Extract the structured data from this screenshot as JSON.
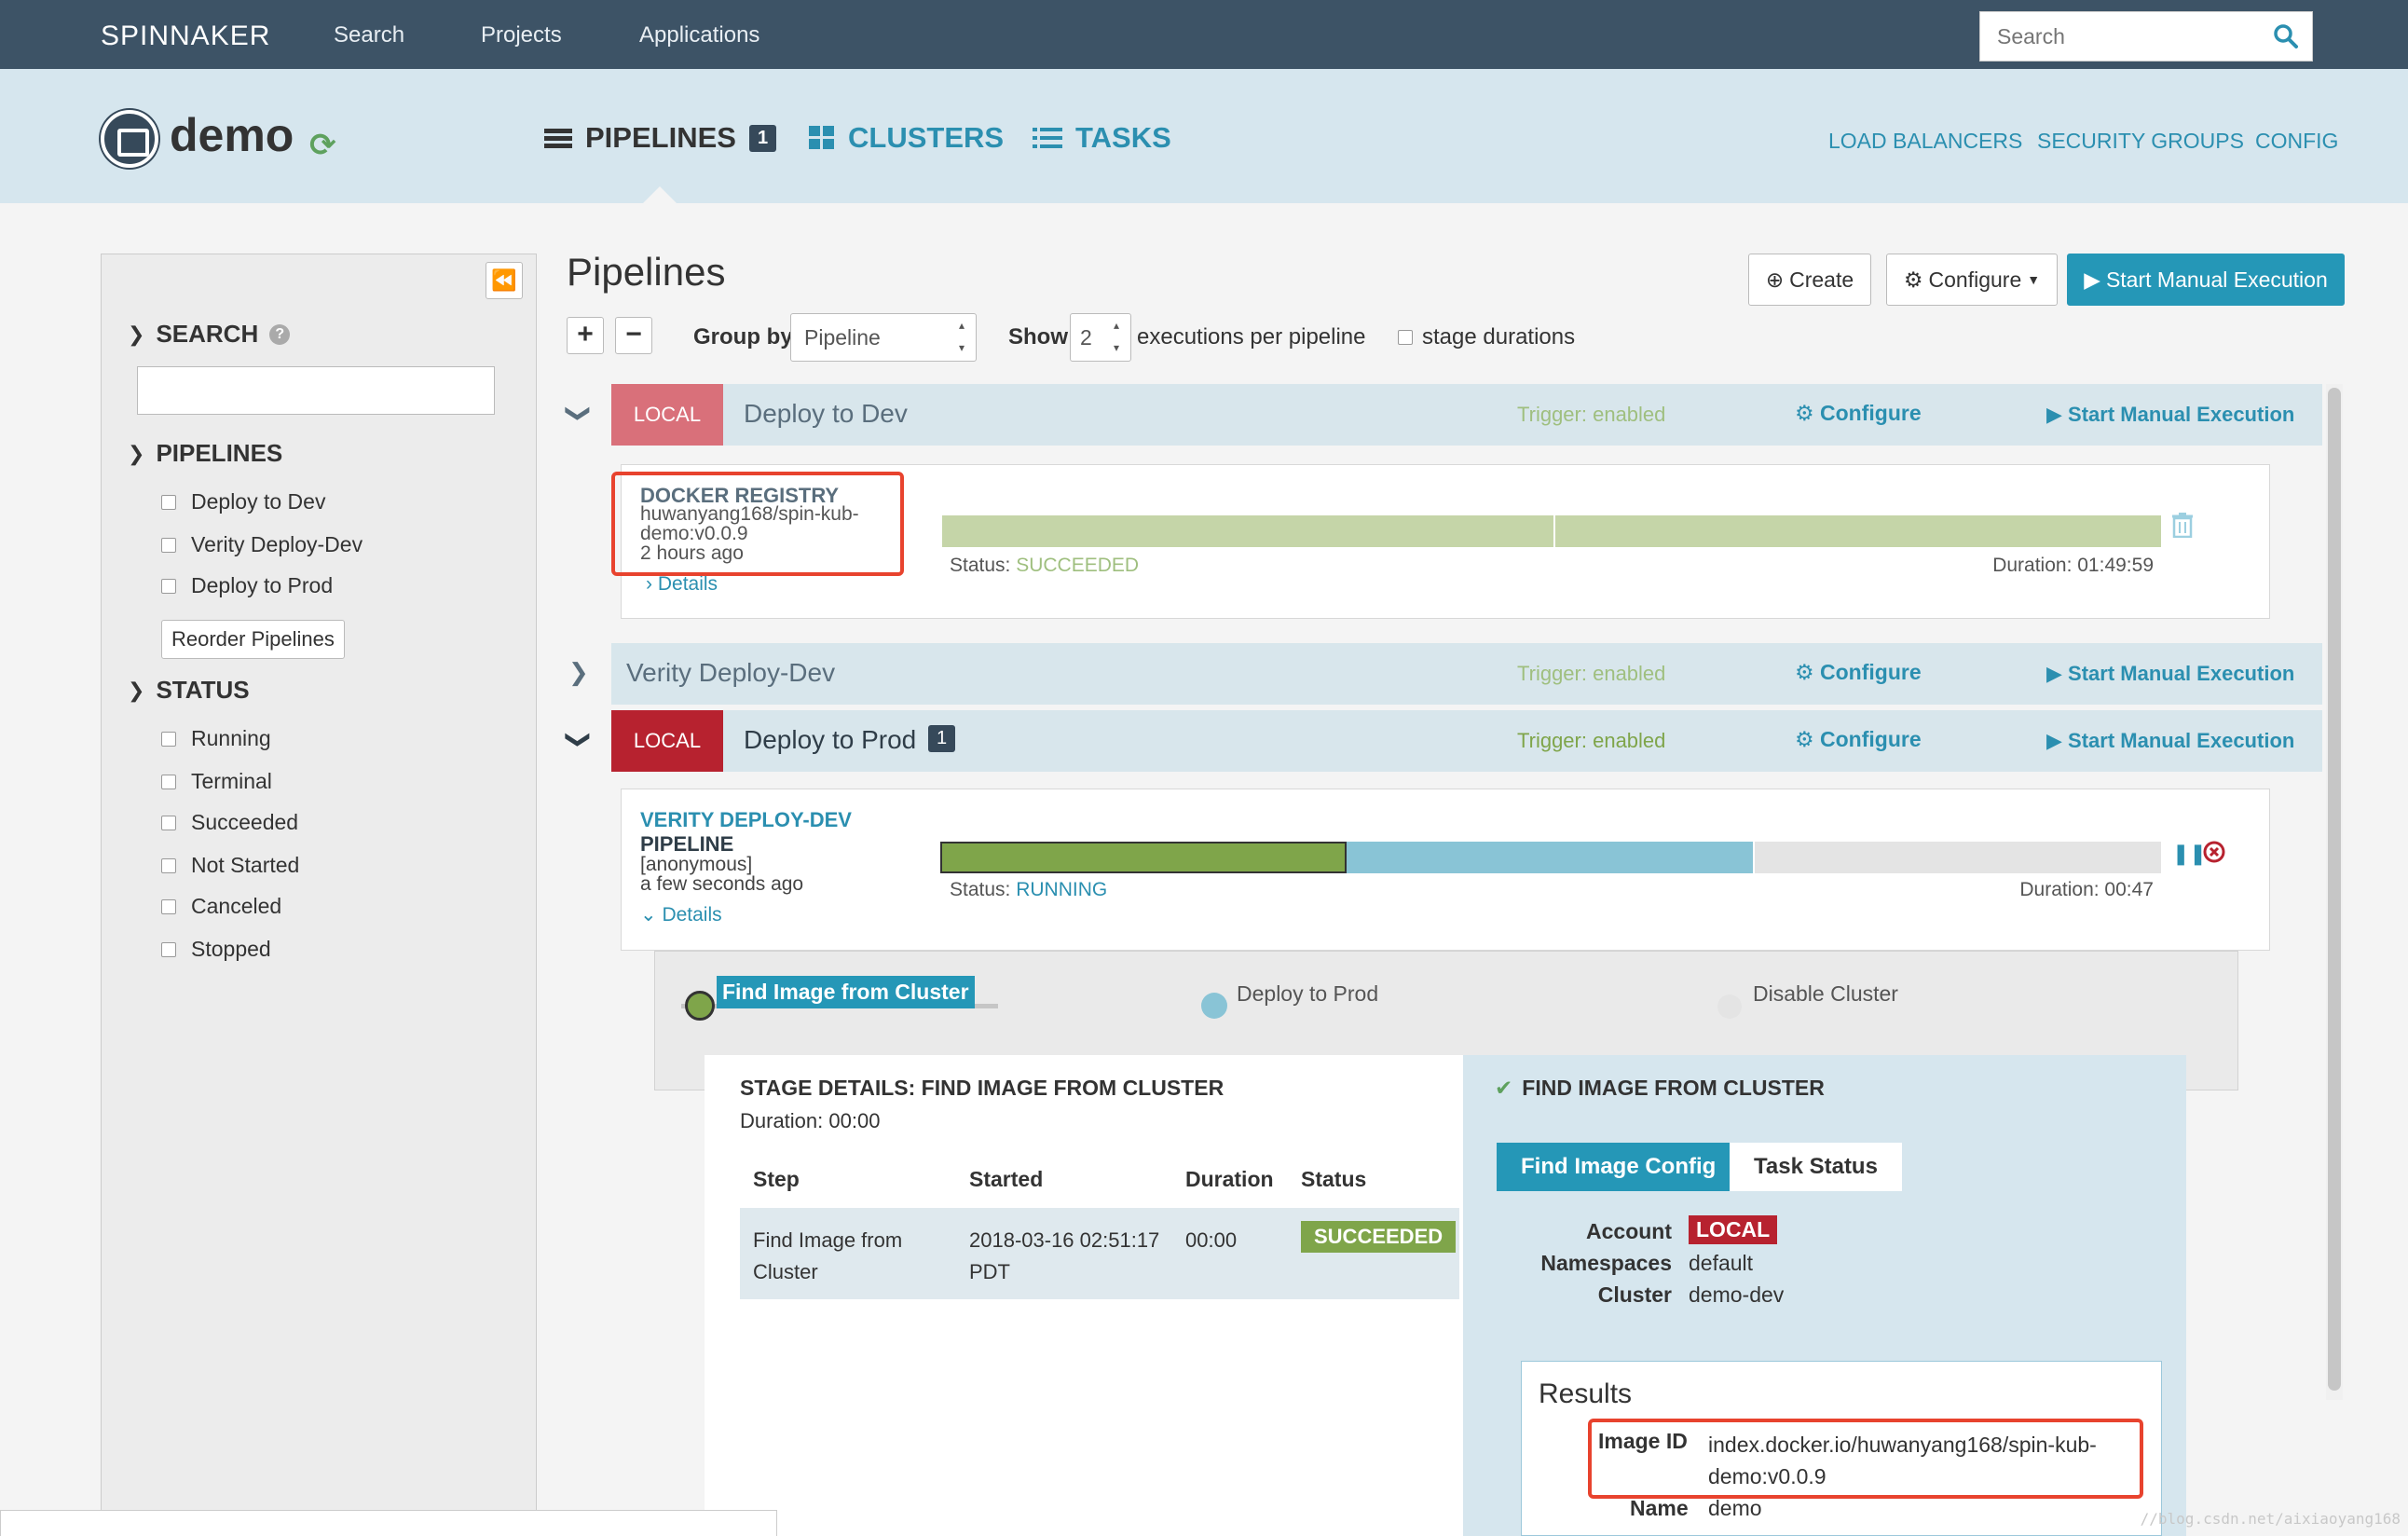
{
  "topnav": {
    "brand": "SPINNAKER",
    "links": [
      "Search",
      "Projects",
      "Applications"
    ],
    "search_placeholder": "Search"
  },
  "app": {
    "name": "demo",
    "tabs": [
      {
        "label": "PIPELINES",
        "badge": "1",
        "icon": "list-icon"
      },
      {
        "label": "CLUSTERS",
        "icon": "grid-icon"
      },
      {
        "label": "TASKS",
        "icon": "tasks-icon"
      }
    ],
    "secondary_tabs": [
      "LOAD BALANCERS",
      "SECURITY GROUPS",
      "CONFIG"
    ]
  },
  "sidebar": {
    "search_header": "SEARCH",
    "pipelines_header": "PIPELINES",
    "pipelines": [
      "Deploy to Dev",
      "Verity Deploy-Dev",
      "Deploy to Prod"
    ],
    "reorder_label": "Reorder Pipelines",
    "status_header": "STATUS",
    "statuses": [
      "Running",
      "Terminal",
      "Succeeded",
      "Not Started",
      "Canceled",
      "Stopped"
    ]
  },
  "main": {
    "title": "Pipelines",
    "create_label": "Create",
    "configure_label": "Configure",
    "start_label": "Start Manual Execution",
    "group_by_label": "Group by",
    "group_by_value": "Pipeline",
    "show_label": "Show",
    "show_value": "2",
    "per_pipeline_label": "executions per pipeline",
    "stage_durations_label": "stage durations"
  },
  "pipelines": [
    {
      "tag": "LOCAL",
      "name": "Deploy to Dev",
      "trigger": "Trigger: enabled",
      "configure": "Configure",
      "start": "Start Manual Execution",
      "execution": {
        "source_title": "DOCKER REGISTRY",
        "source_line1": "huwanyang168/spin-kub-",
        "source_line2": "demo:v0.0.9",
        "time": "2 hours ago",
        "details": "Details",
        "status_label": "Status:",
        "status": "SUCCEEDED",
        "duration": "Duration: 01:49:59"
      }
    },
    {
      "name": "Verity Deploy-Dev",
      "trigger": "Trigger: enabled",
      "configure": "Configure",
      "start": "Start Manual Execution"
    },
    {
      "tag": "LOCAL",
      "name": "Deploy to Prod",
      "badge": "1",
      "trigger": "Trigger: enabled",
      "configure": "Configure",
      "start": "Start Manual Execution",
      "execution": {
        "source_title": "VERITY DEPLOY-DEV",
        "source_sub": "PIPELINE",
        "user": "[anonymous]",
        "time": "a few seconds ago",
        "details": "Details",
        "status_label": "Status:",
        "status": "RUNNING",
        "duration": "Duration: 00:47",
        "stages": [
          "Find Image from Cluster",
          "Deploy to Prod",
          "Disable Cluster"
        ]
      }
    }
  ],
  "stage_details": {
    "title": "STAGE DETAILS: FIND IMAGE FROM CLUSTER",
    "duration": "Duration: 00:00",
    "columns": [
      "Step",
      "Started",
      "Duration",
      "Status"
    ],
    "row": {
      "step_line1": "Find Image from",
      "step_line2": "Cluster",
      "started_line1": "2018-03-16 02:51:17",
      "started_line2": "PDT",
      "duration": "00:00",
      "status": "SUCCEEDED"
    }
  },
  "find_image": {
    "title": "FIND IMAGE FROM CLUSTER",
    "tabs": [
      "Find Image Config",
      "Task Status"
    ],
    "account_label": "Account",
    "account_value": "LOCAL",
    "namespaces_label": "Namespaces",
    "namespaces_value": "default",
    "cluster_label": "Cluster",
    "cluster_value": "demo-dev",
    "results_title": "Results",
    "image_id_label": "Image ID",
    "image_id_line1": "index.docker.io/huwanyang168/spin-kub-",
    "image_id_line2": "demo:v0.0.9",
    "name_label": "Name",
    "name_value": "demo"
  },
  "watermark": "//blog.csdn.net/aixiaoyang168",
  "colors": {
    "topnav": "#3d5366",
    "header": "#d6e6ee",
    "accent": "#2b8fb0",
    "local_tag_dev": "#d9707a",
    "local_tag_prod": "#b7222f",
    "succeeded": "#7fa54a",
    "running_bar": "#89c4d6",
    "highlight": "#e8432e"
  }
}
